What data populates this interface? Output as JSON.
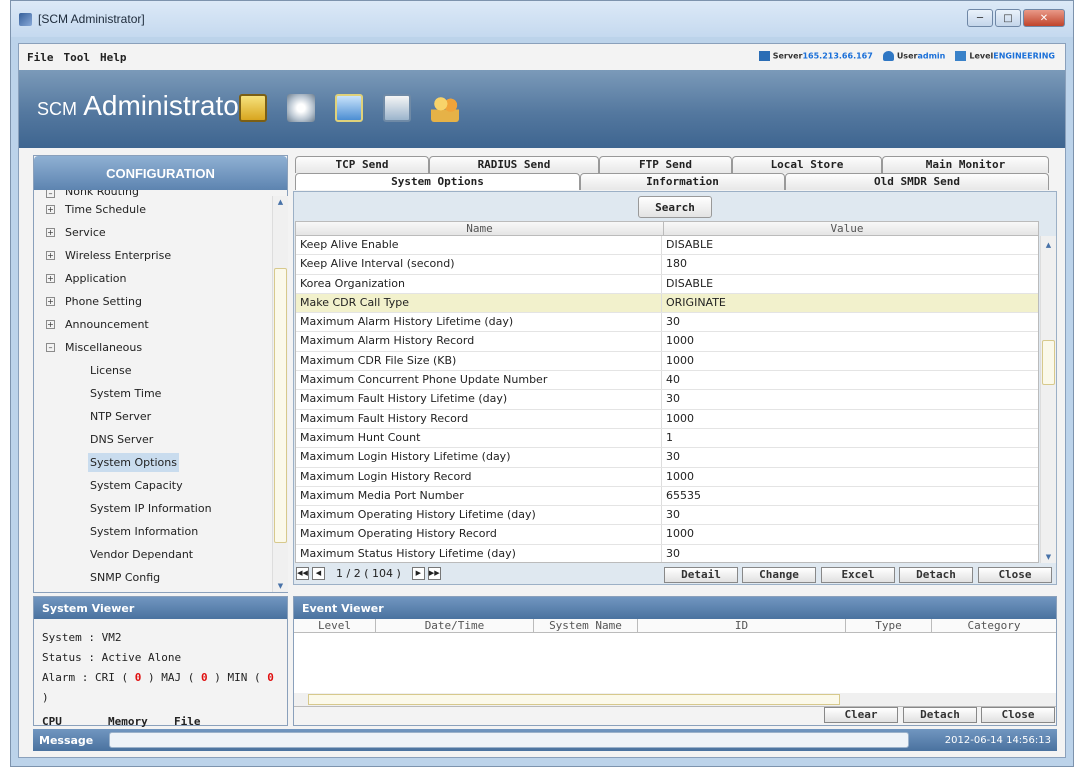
{
  "window": {
    "title": "[SCM Administrator]"
  },
  "menu": [
    "File",
    "Tool",
    "Help"
  ],
  "server_info": {
    "server_label": "Server",
    "server_value": "165.213.66.167",
    "user_label": "User",
    "user_value": "admin",
    "level_label": "Level",
    "level_value": "ENGINEERING"
  },
  "banner": {
    "logo_prefix": "SCM",
    "logo_main": "Administrator"
  },
  "config": {
    "header": "CONFIGURATION",
    "partial_item": "Nonk Routing",
    "groups": [
      "Time Schedule",
      "Service",
      "Wireless Enterprise",
      "Application",
      "Phone Setting",
      "Announcement"
    ],
    "expanded_group": "Miscellaneous",
    "leaves": [
      "License",
      "System Time",
      "NTP Server",
      "DNS Server",
      "System Options",
      "System Capacity",
      "System IP Information",
      "System Information",
      "Vendor Dependant",
      "SNMP Config"
    ],
    "selected": "System Options"
  },
  "tabs": {
    "row1": [
      "TCP Send",
      "RADIUS Send",
      "FTP Send",
      "Local Store",
      "Main Monitor"
    ],
    "row2": [
      "System Options",
      "Information",
      "Old SMDR Send"
    ],
    "active": "System Options"
  },
  "options": {
    "search_label": "Search",
    "columns": [
      "Name",
      "Value"
    ],
    "rows": [
      [
        "Keep Alive Enable",
        "DISABLE"
      ],
      [
        "Keep Alive Interval (second)",
        "180"
      ],
      [
        "Korea Organization",
        "DISABLE"
      ],
      [
        "Make CDR Call Type",
        "ORIGINATE"
      ],
      [
        "Maximum Alarm History Lifetime (day)",
        "30"
      ],
      [
        "Maximum Alarm History Record",
        "1000"
      ],
      [
        "Maximum CDR File Size (KB)",
        "1000"
      ],
      [
        "Maximum Concurrent Phone Update Number",
        "40"
      ],
      [
        "Maximum Fault History Lifetime (day)",
        "30"
      ],
      [
        "Maximum Fault History Record",
        "1000"
      ],
      [
        "Maximum Hunt Count",
        "1"
      ],
      [
        "Maximum Login History Lifetime (day)",
        "30"
      ],
      [
        "Maximum Login History Record",
        "1000"
      ],
      [
        "Maximum Media Port Number",
        "65535"
      ],
      [
        "Maximum Operating History Lifetime (day)",
        "30"
      ],
      [
        "Maximum Operating History Record",
        "1000"
      ],
      [
        "Maximum Status History Lifetime (day)",
        "30"
      ]
    ],
    "highlighted_row": "Make CDR Call Type",
    "pager": "1 / 2 ( 104 )",
    "buttons": [
      "Detail",
      "Change",
      "Excel",
      "Detach",
      "Close"
    ]
  },
  "system_viewer": {
    "header": "System Viewer",
    "system_line": "System : VM2",
    "status_line": "Status  : Active Alone",
    "alarm_label": "Alarm  : CRI (",
    "cri": "0",
    "maj_label": ") MAJ (",
    "maj": "0",
    "min_label": ") MIN (",
    "min": "0",
    "close_paren": ")",
    "meters": [
      "CPU",
      "Memory",
      "File"
    ]
  },
  "event_viewer": {
    "header": "Event Viewer",
    "columns": [
      "Level",
      "Date/Time",
      "System Name",
      "ID",
      "Type",
      "Category"
    ],
    "buttons": [
      "Clear",
      "Detach",
      "Close"
    ]
  },
  "message_bar": {
    "label": "Message",
    "timestamp": "2012-06-14 14:56:13"
  }
}
